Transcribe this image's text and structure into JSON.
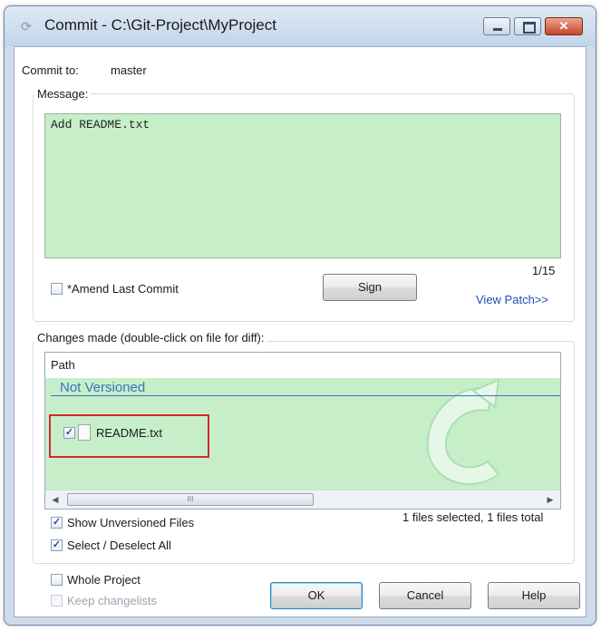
{
  "window": {
    "title": "Commit - C:\\Git-Project\\MyProject",
    "icon": "commit-app-icon",
    "controls": {
      "minimize": "minimize-icon",
      "maximize": "maximize-icon",
      "close": "✕"
    }
  },
  "commit_to": {
    "label": "Commit to:",
    "value": "master"
  },
  "message": {
    "group_label": "Message:",
    "text": "Add README.txt",
    "char_count": "1/15",
    "amend_label": "*Amend Last Commit",
    "amend_checked": false,
    "sign_button": "Sign",
    "view_patch_link": "View Patch>>"
  },
  "changes": {
    "group_label": "Changes made (double-click on file for diff):",
    "column_header": "Path",
    "group_title": "Not Versioned",
    "files": [
      {
        "name": "README.txt",
        "checked": true,
        "checkmark": "✓"
      }
    ],
    "scroll_thumb_grip": "III",
    "status": "1 files selected, 1 files total",
    "show_unversioned_label": "Show Unversioned Files",
    "show_unversioned_checked": true,
    "select_all_label": "Select / Deselect All",
    "select_all_checked": true
  },
  "bottom": {
    "whole_project_label": "Whole Project",
    "whole_project_checked": false,
    "keep_changelists_label": "Keep changelists",
    "keep_changelists_enabled": false,
    "ok_button": "OK",
    "cancel_button": "Cancel",
    "help_button": "Help"
  },
  "colors": {
    "accent_green": "#c6efc9",
    "link_blue": "#1c4fb0",
    "highlight_red": "#d4282f",
    "group_blue": "#3a72c2"
  }
}
